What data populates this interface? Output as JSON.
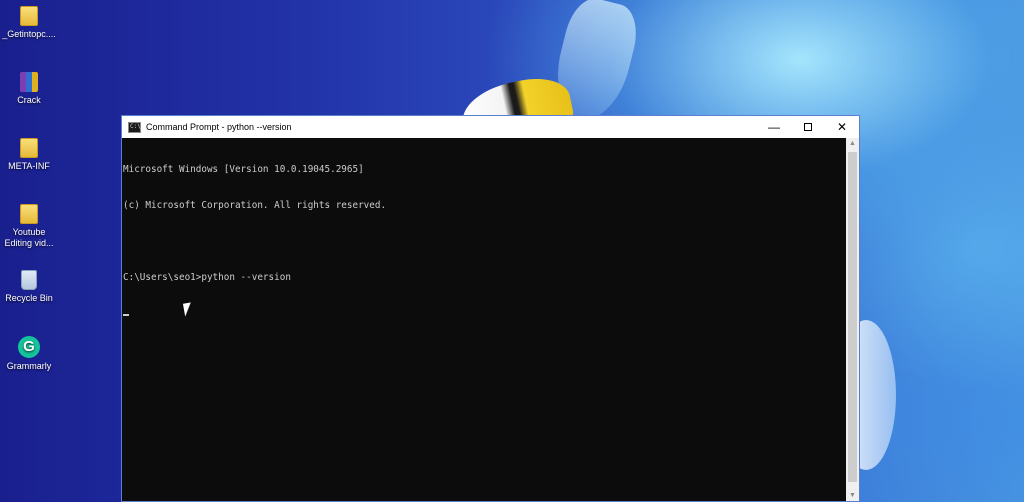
{
  "desktop": {
    "icons": [
      {
        "label": "_Getintopc....",
        "icon": "folder-icon"
      },
      {
        "label": "Crack",
        "icon": "winrar-icon"
      },
      {
        "label": "META-INF",
        "icon": "folder-icon"
      },
      {
        "label": "Youtube Editing vid...",
        "icon": "folder-icon"
      },
      {
        "label": "Recycle Bin",
        "icon": "recycle-bin-icon"
      },
      {
        "label": "Grammarly",
        "icon": "grammarly-icon",
        "glyph": "G"
      }
    ]
  },
  "window": {
    "title": "Command Prompt - python  --version",
    "icon_glyph": "C:\\",
    "controls": {
      "minimize": "—",
      "close": "✕"
    }
  },
  "console": {
    "lines": [
      "Microsoft Windows [Version 10.0.19045.2965]",
      "(c) Microsoft Corporation. All rights reserved.",
      "",
      "C:\\Users\\seo1>python --version"
    ]
  },
  "colors": {
    "console_bg": "#0c0c0c",
    "console_text": "#cccccc",
    "titlebar_bg": "#ffffff",
    "desktop_blue": "#2233a8"
  }
}
